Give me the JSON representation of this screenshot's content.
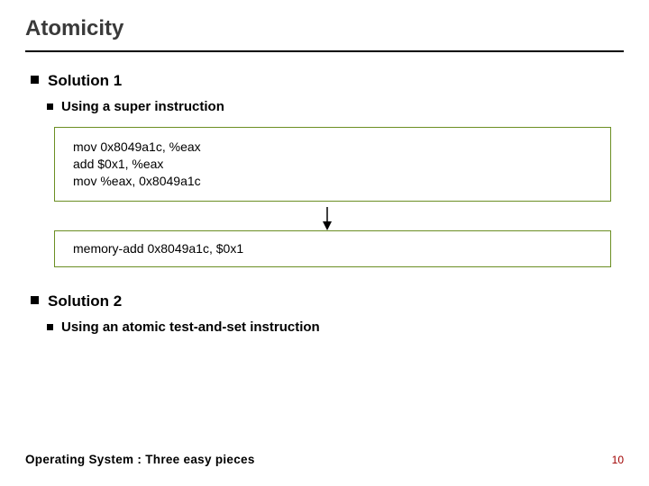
{
  "title": "Atomicity",
  "solution1": {
    "heading": "Solution 1",
    "sub": "Using a super instruction",
    "code_before": {
      "l1": "mov 0x8049a1c, %eax",
      "l2": "add $0x1, %eax",
      "l3": "mov %eax, 0x8049a1c"
    },
    "code_after": {
      "l1": "memory-add 0x8049a1c, $0x1"
    }
  },
  "solution2": {
    "heading": "Solution 2",
    "sub": "Using an atomic test-and-set instruction"
  },
  "footer": {
    "text": "Operating System : Three easy pieces",
    "page": "10"
  }
}
